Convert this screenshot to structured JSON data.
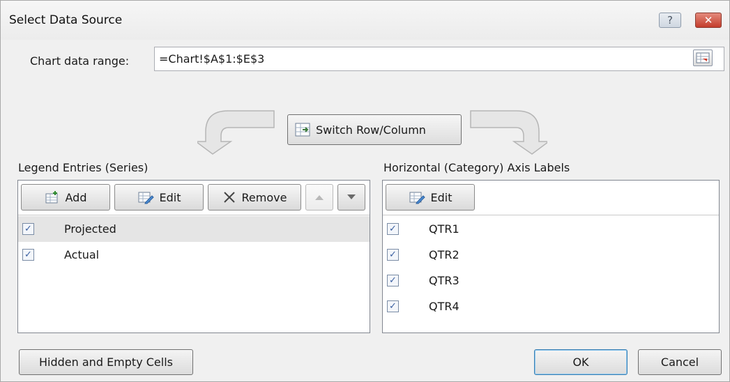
{
  "dialog": {
    "title": "Select Data Source",
    "help_icon": "help-icon",
    "close_icon": "close-icon"
  },
  "range": {
    "label": "Chart data range:",
    "value": "=Chart!$A$1:$E$3"
  },
  "switch_button": {
    "label": "Switch Row/Column"
  },
  "legend": {
    "label": "Legend Entries (Series)",
    "toolbar": {
      "add": "Add",
      "edit": "Edit",
      "remove": "Remove"
    },
    "items": [
      {
        "label": "Projected",
        "checked": true,
        "selected": true
      },
      {
        "label": "Actual",
        "checked": true,
        "selected": false
      }
    ]
  },
  "axis": {
    "label": "Horizontal (Category) Axis Labels",
    "toolbar": {
      "edit": "Edit"
    },
    "items": [
      {
        "label": "QTR1",
        "checked": true
      },
      {
        "label": "QTR2",
        "checked": true
      },
      {
        "label": "QTR3",
        "checked": true
      },
      {
        "label": "QTR4",
        "checked": true
      }
    ]
  },
  "footer": {
    "hidden_cells": "Hidden and Empty Cells",
    "ok": "OK",
    "cancel": "Cancel"
  },
  "colors": {
    "dialog_bg": "#f0f0f0",
    "close_red": "#c43d2c",
    "selected_row": "#e5e5e5",
    "default_button_border": "#3c7fb1"
  }
}
